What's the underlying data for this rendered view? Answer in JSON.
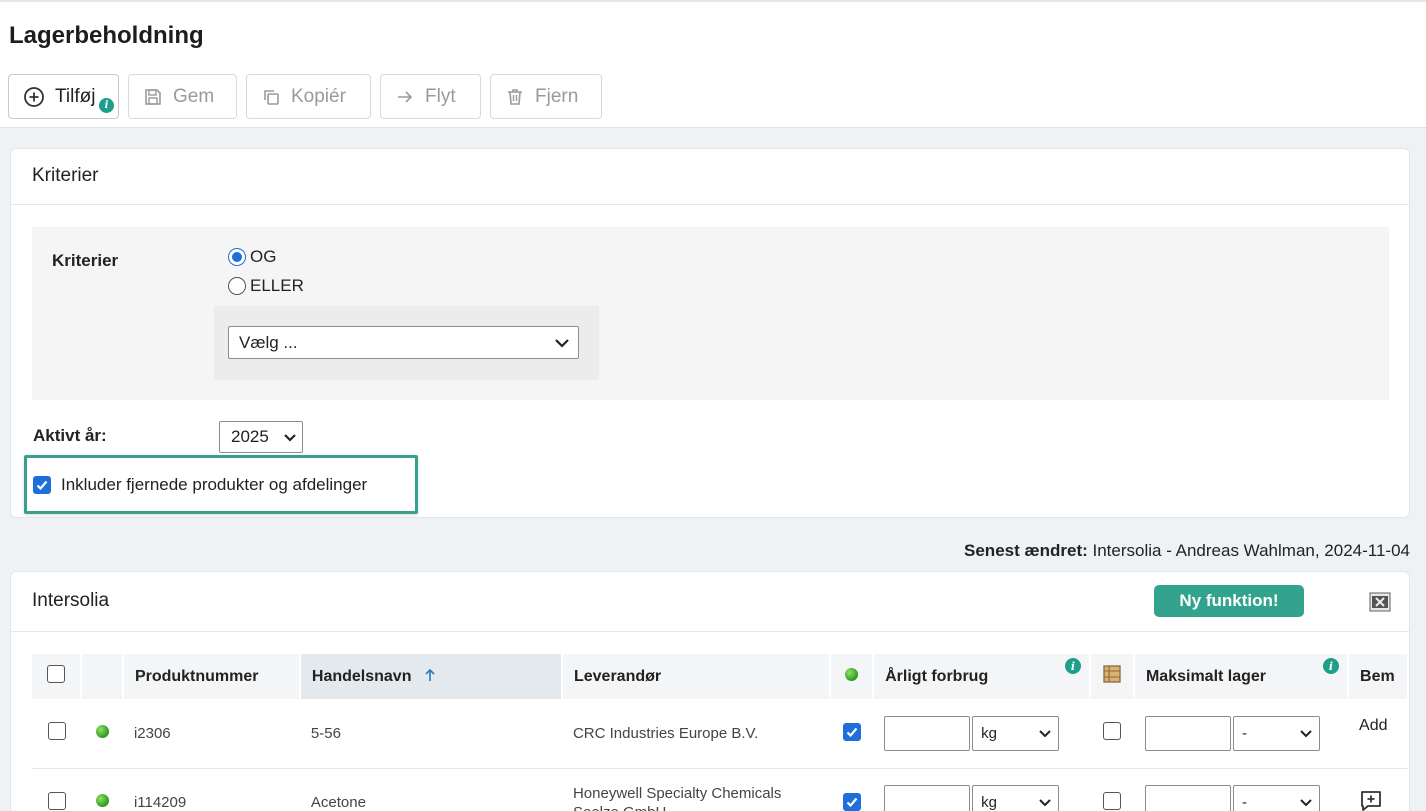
{
  "page": {
    "title": "Lagerbeholdning"
  },
  "toolbar": {
    "add": "Tilføj",
    "save": "Gem",
    "copy": "Kopiér",
    "move": "Flyt",
    "remove": "Fjern",
    "info_badge": "i"
  },
  "criteria_card": {
    "title": "Kriterier",
    "label": "Kriterier",
    "radio_and": "OG",
    "radio_or": "ELLER",
    "select_value": "Vælg ...",
    "year_label": "Aktivt år:",
    "year_value": "2025",
    "include_removed": "Inkluder fjernede produkter og afdelinger"
  },
  "last_changed": {
    "label": "Senest ændret:",
    "value": " Intersolia - Andreas Wahlman, 2024-11-04"
  },
  "table_card": {
    "title": "Intersolia",
    "new_feature": "Ny funktion!",
    "info_badge": "i",
    "headers": {
      "product_number": "Produktnummer",
      "trade_name": "Handelsnavn",
      "supplier": "Leverandør",
      "annual_usage": "Årligt forbrug",
      "max_stock": "Maksimalt lager",
      "remarks": "Bem"
    },
    "rows": [
      {
        "product_number": "i2306",
        "trade_name": "5-56",
        "supplier": "CRC Industries Europe B.V.",
        "unit": "kg",
        "max_unit": "-",
        "remark": "Add"
      },
      {
        "product_number": "i114209",
        "trade_name": "Acetone",
        "supplier_line1": "Honeywell Specialty Chemicals",
        "supplier_line2": "Seelze GmbH",
        "unit": "kg",
        "max_unit": "-"
      }
    ]
  },
  "colors": {
    "accent": "#33a38e",
    "highlight_border": "#3aa08e",
    "checkbox_blue": "#1e6fd9"
  }
}
